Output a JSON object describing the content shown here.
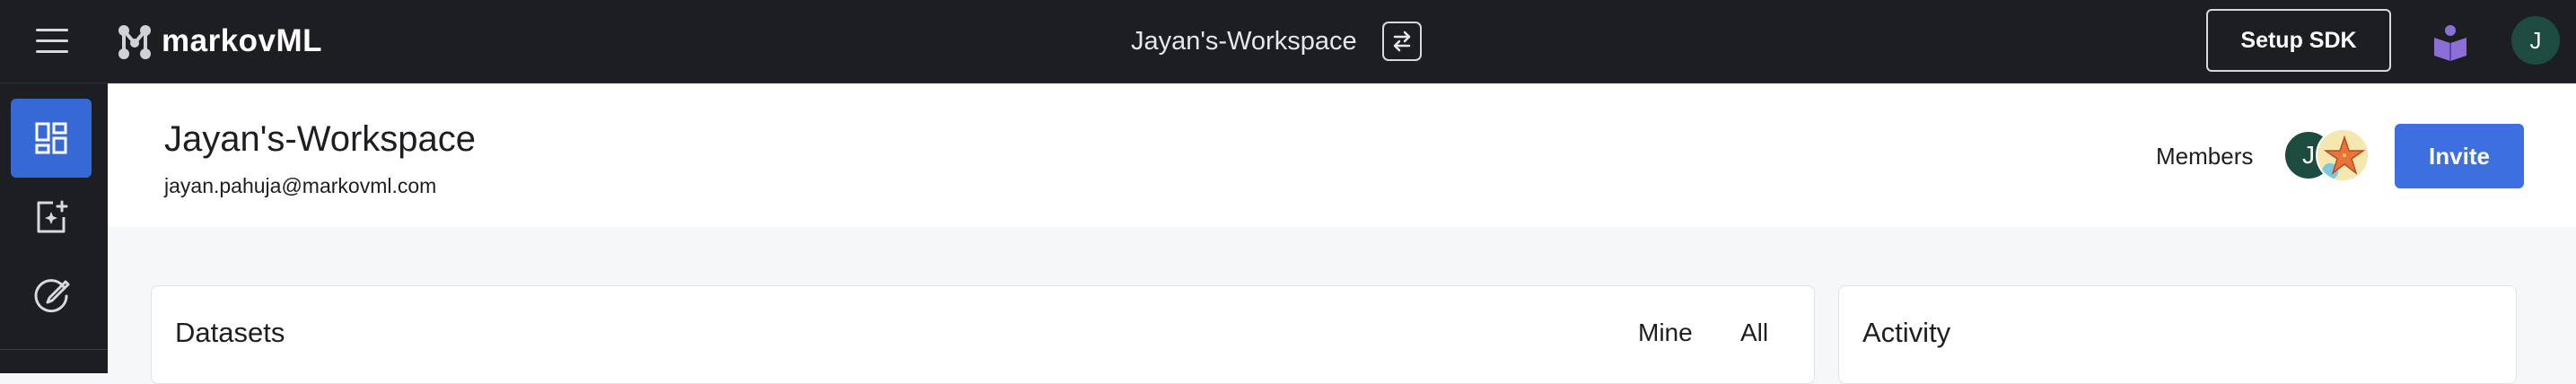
{
  "app": {
    "brand_name": "markovML",
    "colors": {
      "topbar_bg": "#1c1e22",
      "accent": "#3e6fe0",
      "active_nav": "#3769d4",
      "avatar_bg": "#1d4b3f"
    }
  },
  "topbar": {
    "menu_icon": "hamburger-icon",
    "workspace_name": "Jayan's-Workspace",
    "switch_icon": "switch-arrows-icon",
    "setup_sdk_label": "Setup SDK",
    "docs_icon": "book-reader-icon",
    "user_initial": "J"
  },
  "sidebar": {
    "items": [
      {
        "icon": "dashboard-icon",
        "active": true
      },
      {
        "icon": "add-sparkle-icon",
        "active": false
      },
      {
        "icon": "edit-circle-icon",
        "active": false
      }
    ]
  },
  "workspace": {
    "title": "Jayan's-Workspace",
    "email": "jayan.pahuja@markovml.com",
    "members_label": "Members",
    "members": [
      {
        "initial": "J"
      },
      {
        "avatar": "starfish-avatar"
      }
    ],
    "invite_label": "Invite"
  },
  "main": {
    "datasets": {
      "title": "Datasets",
      "tabs": [
        "Mine",
        "All"
      ]
    },
    "activity": {
      "title": "Activity"
    }
  }
}
